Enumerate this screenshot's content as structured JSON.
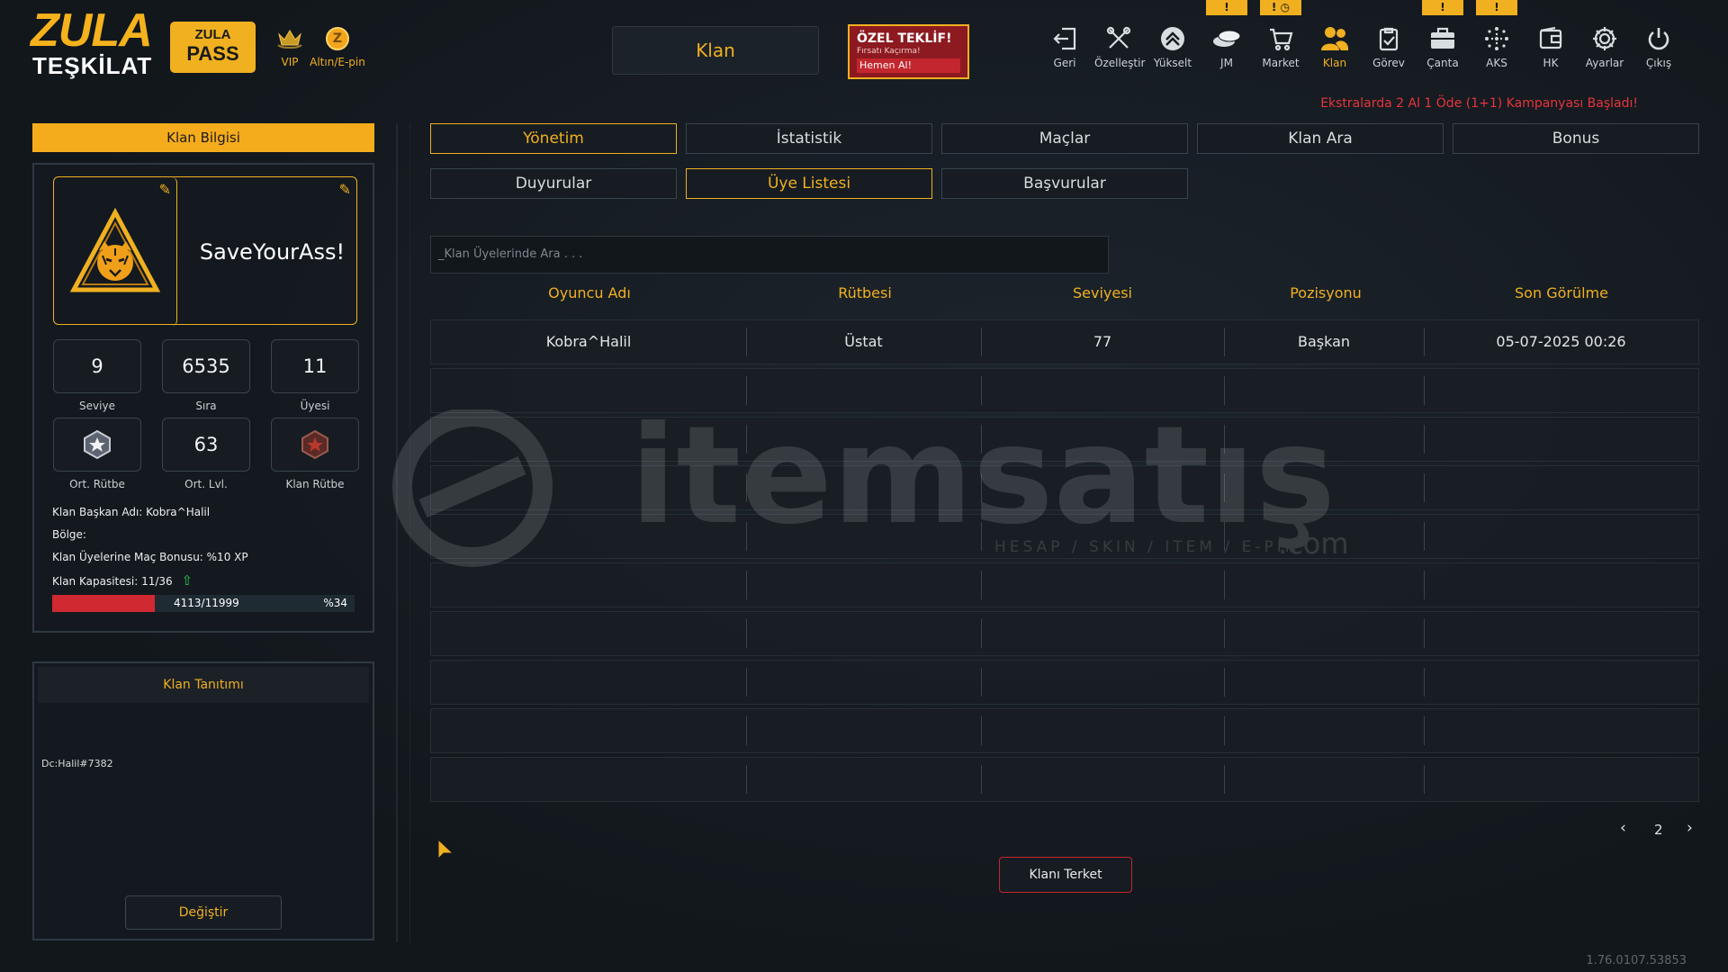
{
  "header": {
    "logo_line1": "ZULA",
    "logo_line2": "TEŞKİLAT",
    "pass_line1": "ZULA",
    "pass_line2": "PASS",
    "vip_label": "VIP",
    "gold_label": "Altın/E-pin",
    "gold_coin_glyph": "Z",
    "page_title": "Klan",
    "offer": {
      "title": "ÖZEL TEKLİF!",
      "subtitle": "Fırsatı Kaçırma!",
      "cta": "Hemen Al!"
    },
    "nav": [
      {
        "label": "Geri",
        "icon": "back-icon"
      },
      {
        "label": "Özelleştir",
        "icon": "tools-icon"
      },
      {
        "label": "Yükselt",
        "icon": "upgrade-icon"
      },
      {
        "label": "JM",
        "icon": "coins-icon"
      },
      {
        "label": "Market",
        "icon": "cart-icon"
      },
      {
        "label": "Klan",
        "icon": "clan-icon"
      },
      {
        "label": "Görev",
        "icon": "mission-icon"
      },
      {
        "label": "Çanta",
        "icon": "bag-icon"
      },
      {
        "label": "AKS",
        "icon": "aks-icon"
      },
      {
        "label": "HK",
        "icon": "wallet-icon"
      },
      {
        "label": "Ayarlar",
        "icon": "gear-icon"
      },
      {
        "label": "Çıkış",
        "icon": "power-icon"
      }
    ],
    "badge_glyph": "!",
    "promo": "Ekstralarda 2 Al 1 Öde (1+1) Kampanyası Başladı!"
  },
  "clan_info": {
    "header": "Klan Bilgisi",
    "name": "SaveYourAss!",
    "stats": [
      {
        "value": "9",
        "label": "Seviye"
      },
      {
        "value": "6535",
        "label": "Sıra"
      },
      {
        "value": "11",
        "label": "Üyesi"
      },
      {
        "value": "",
        "label": "Ort. Rütbe"
      },
      {
        "value": "63",
        "label": "Ort. Lvl."
      },
      {
        "value": "",
        "label": "Klan Rütbe"
      }
    ],
    "leader": "Klan Başkan Adı: Kobra^Halil",
    "region": "Bölge:",
    "bonus": "Klan Üyelerine Maç Bonusu: %10 XP",
    "capacity": "Klan Kapasitesi: 11/36",
    "xp_text": "4113/11999",
    "xp_percent_text": "%34",
    "xp_fraction": 0.34
  },
  "clan_desc": {
    "header": "Klan Tanıtımı",
    "text": "Dc:Halil#7382",
    "change_button": "Değiştir"
  },
  "tabs_row1": [
    "Yönetim",
    "İstatistik",
    "Maçlar",
    "Klan Ara",
    "Bonus"
  ],
  "tabs_row2": [
    "Duyurular",
    "Üye Listesi",
    "Başvurular"
  ],
  "search_placeholder": "_Klan Üyelerinde Ara . . .",
  "table": {
    "columns": [
      "Oyuncu Adı",
      "Rütbesi",
      "Seviyesi",
      "Pozisyonu",
      "Son Görülme"
    ],
    "rows": [
      [
        "Kobra^Halil",
        "Üstat",
        "77",
        "Başkan",
        "05-07-2025 00:26"
      ]
    ],
    "empty_rows": 9
  },
  "pager": {
    "prev": "‹",
    "page": "2",
    "next": "›"
  },
  "leave_button": "Klanı Terket",
  "watermark": {
    "brand": "itemsatış",
    "tagline": "HESAP / SKIN / ITEM / E-PIN",
    "suffix": ".com"
  },
  "version": "1.76.0107.53853",
  "colors": {
    "accent": "#f0b020",
    "danger": "#d02932",
    "background": "#141a20"
  }
}
